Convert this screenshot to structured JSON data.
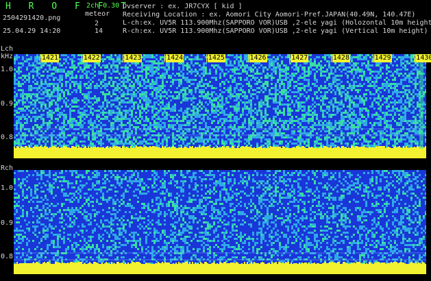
{
  "header": {
    "app_title": "H R O F F T",
    "file_name": "2504291420.png",
    "date_time": "25.04.29 14:20",
    "mode": "2ch 0.30",
    "meteor_label": "meteor",
    "count_a": "2",
    "count_b": "14",
    "info_lines": [
      "Ovserver             : ex. JR7CYX [ kid ]",
      "Receiving Location : ex. Aomori City Aomori-Pref.JAPAN(40.49N, 140.47E)",
      "L-ch:ex. UV5R 113.900Mhz(SAPPORO VOR)USB ,2-ele yagi (Holozontal 10m height",
      "R-ch:ex. UV5R 113.900Mhz(SAPPORO VOR)USB ,2-ele yagi (Vertical 10m height)"
    ]
  },
  "left_channel": {
    "label": "Lch",
    "unit": "kHz",
    "y_ticks": [
      "1.0",
      "0.9",
      "0.8"
    ]
  },
  "right_channel": {
    "label": "Rch",
    "y_ticks": [
      "1.0",
      "0.9",
      "0.8"
    ]
  },
  "time_ticks": [
    "1421",
    "1422",
    "1423",
    "1424",
    "1425",
    "1426",
    "1427",
    "1428",
    "1429",
    "1430"
  ],
  "colors": {
    "background": "#000000",
    "spectrum_low": "#1a36d8",
    "spectrum_mid": "#2fa8e8",
    "spectrum_high": "#38e0a0",
    "baseline": "#f2f230",
    "title_green": "#55ff55"
  }
}
